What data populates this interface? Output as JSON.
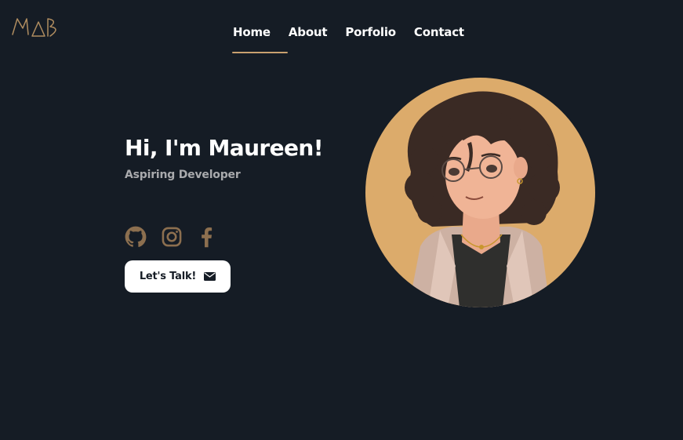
{
  "brand": {
    "logo_text": "MAB",
    "accent": "#c9a16f"
  },
  "nav": {
    "items": [
      {
        "label": "Home"
      },
      {
        "label": "About"
      },
      {
        "label": "Porfolio"
      },
      {
        "label": "Contact"
      }
    ],
    "active": "Home"
  },
  "hero": {
    "title": "Hi, I'm Maureen!",
    "subtitle": "Aspiring Developer",
    "social_icons": [
      "github-icon",
      "instagram-icon",
      "facebook-icon"
    ],
    "cta_label": "Let's Talk!",
    "cta_icon": "envelope-icon"
  },
  "colors": {
    "background": "#151c25",
    "avatar_bg": "#dcab6b",
    "social_icon": "#8c6f4f"
  }
}
